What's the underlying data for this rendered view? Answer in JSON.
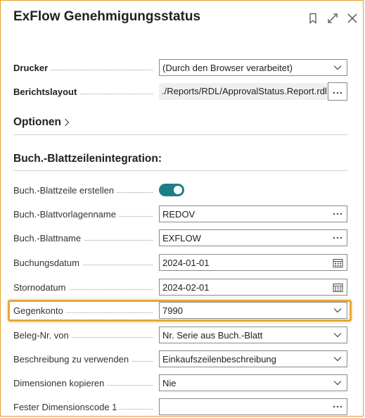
{
  "dialog": {
    "title": "ExFlow Genehmigungsstatus"
  },
  "printer": {
    "label": "Drucker",
    "value": "(Durch den Browser verarbeitet)"
  },
  "report_layout": {
    "label": "Berichtslayout",
    "value": "./Reports/RDL/ApprovalStatus.Report.rdl"
  },
  "options": {
    "label": "Optionen"
  },
  "journal_section": {
    "title": "Buch.-Blattzeilenintegration:",
    "fields": {
      "create_line": {
        "label": "Buch.-Blattzeile erstellen",
        "value": true
      },
      "template_name": {
        "label": "Buch.-Blattvorlagenname",
        "value": "REDOV"
      },
      "batch_name": {
        "label": "Buch.-Blattname",
        "value": "EXFLOW"
      },
      "posting_date": {
        "label": "Buchungsdatum",
        "value": "2024-01-01"
      },
      "reversal_date": {
        "label": "Stornodatum",
        "value": "2024-02-01"
      },
      "balance_account": {
        "label": "Gegenkonto",
        "value": "7990"
      },
      "document_no_from": {
        "label": "Beleg-Nr. von",
        "value": "Nr. Serie aus Buch.-Blatt"
      },
      "description_to_use": {
        "label": "Beschreibung zu verwenden",
        "value": "Einkaufszeilenbeschreibung"
      },
      "copy_dimensions": {
        "label": "Dimensionen kopieren",
        "value": "Nie"
      },
      "fixed_dimension_code_1": {
        "label": "Fester Dimensionscode 1",
        "value": ""
      }
    }
  },
  "colors": {
    "accent": "#1e7e87",
    "highlight": "#e8a637",
    "border": "#e4a12a"
  },
  "icons": [
    "bookmark-icon",
    "expand-icon",
    "close-icon",
    "chevron-down-icon",
    "ellipsis-icon",
    "calendar-icon",
    "chevron-right-icon"
  ]
}
